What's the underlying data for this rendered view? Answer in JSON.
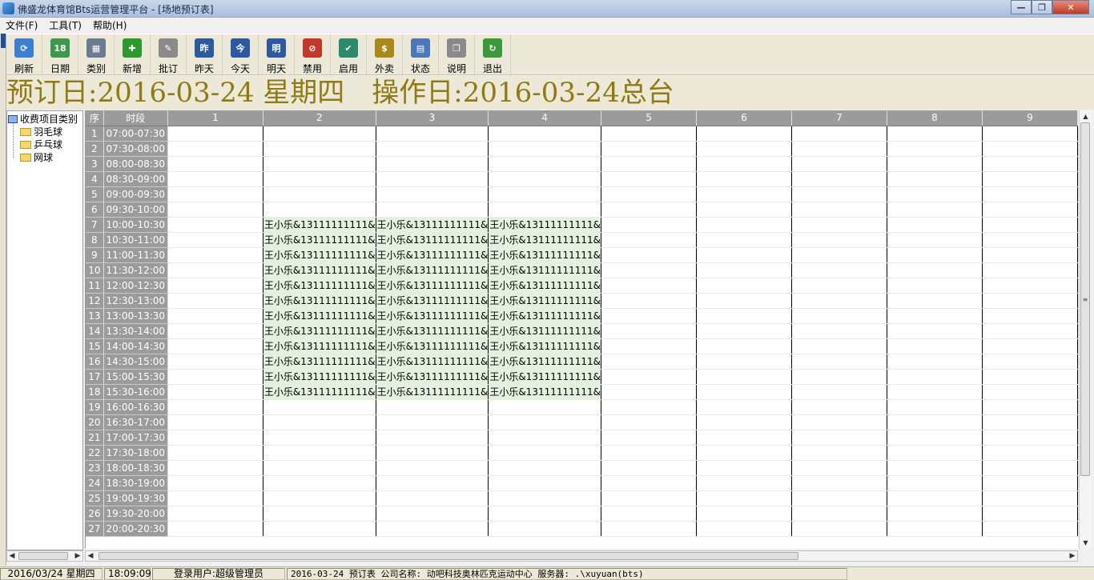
{
  "window": {
    "title": "佛盛龙体育馆Bts运营管理平台 - [场地预订表]"
  },
  "menu": [
    "文件(F)",
    "工具(T)",
    "帮助(H)"
  ],
  "toolbar": [
    {
      "label": "刷新",
      "icon": "refresh-icon",
      "color": "#3a7fd0",
      "glyph": "⟳"
    },
    {
      "label": "日期",
      "icon": "calendar-icon",
      "color": "#3a9a4a",
      "glyph": "18"
    },
    {
      "label": "类别",
      "icon": "category-icon",
      "color": "#6a7a90",
      "glyph": "▦"
    },
    {
      "label": "新增",
      "icon": "add-icon",
      "color": "#2e9a2e",
      "glyph": "✚"
    },
    {
      "label": "批订",
      "icon": "batch-icon",
      "color": "#8a8a8a",
      "glyph": "✎"
    },
    {
      "label": "昨天",
      "icon": "yesterday-icon",
      "color": "#2c5aa0",
      "glyph": "昨"
    },
    {
      "label": "今天",
      "icon": "today-icon",
      "color": "#2c5aa0",
      "glyph": "今"
    },
    {
      "label": "明天",
      "icon": "tomorrow-icon",
      "color": "#2c5aa0",
      "glyph": "明"
    },
    {
      "label": "禁用",
      "icon": "disable-icon",
      "color": "#c0392b",
      "glyph": "⊘"
    },
    {
      "label": "启用",
      "icon": "enable-icon",
      "color": "#2a8a6a",
      "glyph": "✔"
    },
    {
      "label": "外卖",
      "icon": "takeout-icon",
      "color": "#a8891a",
      "glyph": "$"
    },
    {
      "label": "状态",
      "icon": "status-icon",
      "color": "#4a78b8",
      "glyph": "▤"
    },
    {
      "label": "说明",
      "icon": "help-book-icon",
      "color": "#8a8a8a",
      "glyph": "❐"
    },
    {
      "label": "退出",
      "icon": "exit-icon",
      "color": "#3a9a3a",
      "glyph": "↻"
    }
  ],
  "banner": "预订日:2016-03-24 星期四　操作日:2016-03-24总台",
  "tree": {
    "root": "收费项目类别",
    "items": [
      "羽毛球",
      "乒乓球",
      "网球"
    ]
  },
  "grid": {
    "headers": {
      "seq": "序",
      "time": "时段",
      "courts": [
        "1",
        "2",
        "3",
        "4",
        "5",
        "6",
        "7",
        "8",
        "9"
      ]
    },
    "booking_text": "王小乐&13111111111&",
    "rows": [
      {
        "n": "1",
        "t": "07:00-07:30",
        "b": []
      },
      {
        "n": "2",
        "t": "07:30-08:00",
        "b": []
      },
      {
        "n": "3",
        "t": "08:00-08:30",
        "b": []
      },
      {
        "n": "4",
        "t": "08:30-09:00",
        "b": []
      },
      {
        "n": "5",
        "t": "09:00-09:30",
        "b": []
      },
      {
        "n": "6",
        "t": "09:30-10:00",
        "b": []
      },
      {
        "n": "7",
        "t": "10:00-10:30",
        "b": [
          2,
          3,
          4
        ]
      },
      {
        "n": "8",
        "t": "10:30-11:00",
        "b": [
          2,
          3,
          4
        ]
      },
      {
        "n": "9",
        "t": "11:00-11:30",
        "b": [
          2,
          3,
          4
        ]
      },
      {
        "n": "10",
        "t": "11:30-12:00",
        "b": [
          2,
          3,
          4
        ]
      },
      {
        "n": "11",
        "t": "12:00-12:30",
        "b": [
          2,
          3,
          4
        ]
      },
      {
        "n": "12",
        "t": "12:30-13:00",
        "b": [
          2,
          3,
          4
        ]
      },
      {
        "n": "13",
        "t": "13:00-13:30",
        "b": [
          2,
          3,
          4
        ]
      },
      {
        "n": "14",
        "t": "13:30-14:00",
        "b": [
          2,
          3,
          4
        ]
      },
      {
        "n": "15",
        "t": "14:00-14:30",
        "b": [
          2,
          3,
          4
        ]
      },
      {
        "n": "16",
        "t": "14:30-15:00",
        "b": [
          2,
          3,
          4
        ]
      },
      {
        "n": "17",
        "t": "15:00-15:30",
        "b": [
          2,
          3,
          4
        ]
      },
      {
        "n": "18",
        "t": "15:30-16:00",
        "b": [
          2,
          3,
          4
        ]
      },
      {
        "n": "19",
        "t": "16:00-16:30",
        "b": []
      },
      {
        "n": "20",
        "t": "16:30-17:00",
        "b": []
      },
      {
        "n": "21",
        "t": "17:00-17:30",
        "b": []
      },
      {
        "n": "22",
        "t": "17:30-18:00",
        "b": []
      },
      {
        "n": "23",
        "t": "18:00-18:30",
        "b": []
      },
      {
        "n": "24",
        "t": "18:30-19:00",
        "b": []
      },
      {
        "n": "25",
        "t": "19:00-19:30",
        "b": []
      },
      {
        "n": "26",
        "t": "19:30-20:00",
        "b": []
      },
      {
        "n": "27",
        "t": "20:00-20:30",
        "b": []
      }
    ]
  },
  "status": {
    "date": "2016/03/24 星期四",
    "time": "18:09:09",
    "user": "登录用户:超级管理员",
    "info": "2016-03-24 预订表 公司名称: 动吧科技奥林匹克运动中心 服务器: .\\xuyuan(bts)"
  }
}
